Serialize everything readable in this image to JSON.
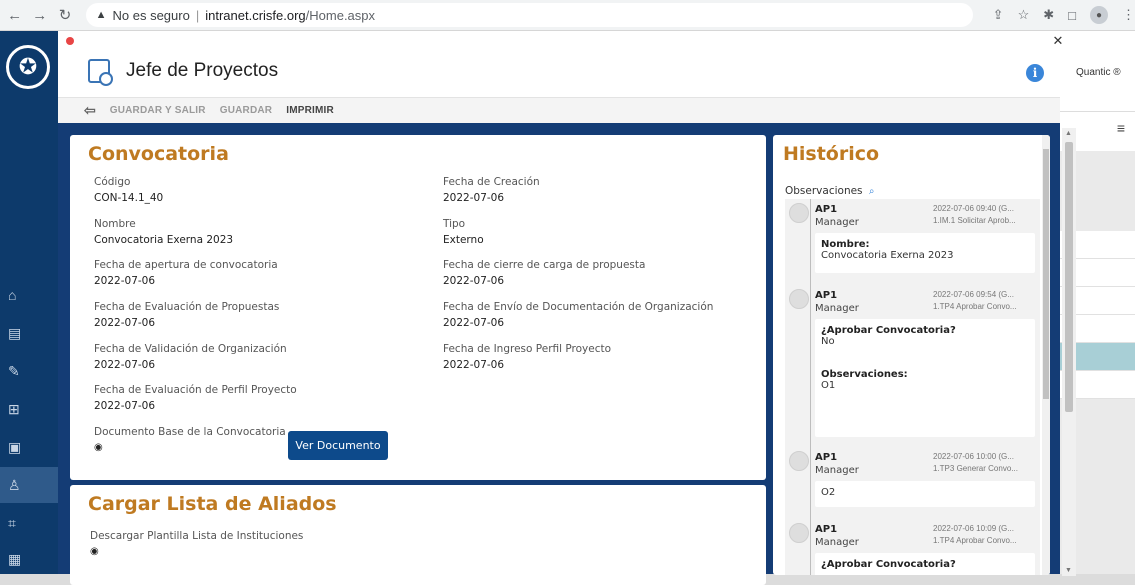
{
  "browser": {
    "url_warning": "No es seguro",
    "url_host": "intranet.crisfe.org",
    "url_path": "/Home.aspx"
  },
  "background_app": {
    "brand_text": "Quantic ®"
  },
  "modal": {
    "title": "Jefe de Proyectos",
    "toolbar": {
      "save_exit": "GUARDAR Y SALIR",
      "save": "GUARDAR",
      "print": "IMPRIMIR"
    }
  },
  "convocatoria": {
    "title": "Convocatoria",
    "fields": [
      {
        "label": "Código",
        "value": "CON-14.1_40"
      },
      {
        "label": "Fecha de Creación",
        "value": "2022-07-06"
      },
      {
        "label": "Nombre",
        "value": "Convocatoria Exerna 2023"
      },
      {
        "label": "Tipo",
        "value": "Externo"
      },
      {
        "label": "Fecha de apertura de convocatoria",
        "value": "2022-07-06"
      },
      {
        "label": "Fecha de cierre de carga de propuesta",
        "value": "2022-07-06"
      },
      {
        "label": "Fecha de Evaluación de Propuestas",
        "value": "2022-07-06"
      },
      {
        "label": "Fecha de Envío de Documentación de Organización",
        "value": "2022-07-06"
      },
      {
        "label": "Fecha de Validación de Organización",
        "value": "2022-07-06"
      },
      {
        "label": "Fecha de Ingreso Perfil Proyecto",
        "value": "2022-07-06"
      },
      {
        "label": "Fecha de Evaluación de Perfil Proyecto",
        "value": "2022-07-06"
      }
    ],
    "document_label": "Documento Base de la Convocatoria",
    "document_button": "Ver Documento"
  },
  "aliados": {
    "title": "Cargar Lista de Aliados",
    "download_label": "Descargar Plantilla Lista de Instituciones"
  },
  "historico": {
    "title": "Histórico",
    "observations_label": "Observaciones",
    "entries": [
      {
        "user": "AP1",
        "role": "Manager",
        "date": "2022-07-06 09:40 (G...",
        "action": "1.IM.1 Solicitar Aprob...",
        "lines": [
          {
            "k": "Nombre:",
            "v": "Convocatoria Exerna 2023"
          }
        ]
      },
      {
        "user": "AP1",
        "role": "Manager",
        "date": "2022-07-06 09:54 (G...",
        "action": "1.TP4 Aprobar Convo...",
        "lines": [
          {
            "k": "¿Aprobar Convocatoria?",
            "v": "No"
          },
          {
            "k": "Observaciones:",
            "v": "O1"
          }
        ]
      },
      {
        "user": "AP1",
        "role": "Manager",
        "date": "2022-07-06 10:00 (G...",
        "action": "1.TP3 Generar Convo...",
        "lines": [
          {
            "k": "",
            "v": "O2"
          }
        ]
      },
      {
        "user": "AP1",
        "role": "Manager",
        "date": "2022-07-06 10:09 (G...",
        "action": "1.TP4 Aprobar Convo...",
        "lines": [
          {
            "k": "¿Aprobar Convocatoria?",
            "v": ""
          }
        ]
      }
    ]
  },
  "colors": {
    "accent": "#bf7a21",
    "navy": "#143c75",
    "button": "#0d4a8b"
  }
}
